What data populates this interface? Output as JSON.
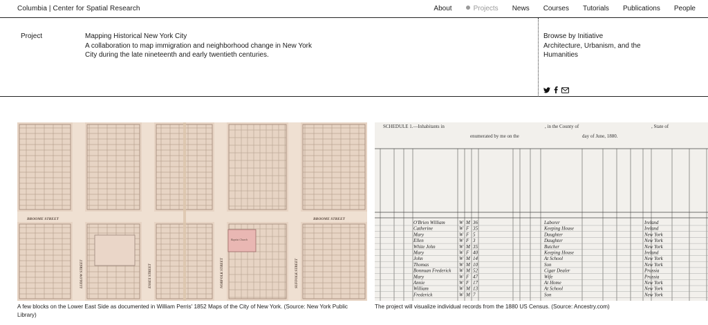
{
  "header": {
    "site_title": "Columbia | Center for Spatial Research",
    "nav": [
      {
        "label": "About",
        "active": false
      },
      {
        "label": "Projects",
        "active": true
      },
      {
        "label": "News",
        "active": false
      },
      {
        "label": "Courses",
        "active": false
      },
      {
        "label": "Tutorials",
        "active": false
      },
      {
        "label": "Publications",
        "active": false
      },
      {
        "label": "People",
        "active": false
      }
    ]
  },
  "project": {
    "label": "Project",
    "title": "Mapping Historical New York City",
    "description": "A collaboration to map immigration and neighborhood change in New York City during the early twentieth centuries.",
    "description_full": "A collaboration to map immigration and neighborhood change in New York City during the late nineteenth and early twentieth centuries."
  },
  "browse": {
    "label": "Browse by Initiative",
    "value": "Architecture, Urbanism, and the Humanities"
  },
  "social": {
    "icons": [
      "twitter-icon",
      "facebook-icon",
      "email-icon"
    ]
  },
  "figures": {
    "map": {
      "street_labels": [
        "BROOME STREET",
        "BROOME STREET",
        "LUDLOW STREET",
        "ESSEX STREET",
        "NORFOLK STREET",
        "SUFFOLK STREET",
        "Baptist Church"
      ],
      "caption": "A few blocks on the Lower East Side as documented in William Perris' 1852 Maps of the City of New York. (Source: New York Public Library)"
    },
    "census": {
      "header_text": "SCHEDULE 1.—Inhabitants in",
      "header_text2": "enumerated by me on the",
      "header_text3": "day of June, 1880.",
      "header_county": ", in the County of",
      "header_state": ", State of",
      "rows": [
        [
          "O'Brien William",
          "W",
          "M",
          "36",
          "Laborer",
          "Ireland"
        ],
        [
          "Catherine",
          "W",
          "F",
          "35",
          "Keeping House",
          "Ireland"
        ],
        [
          "Mary",
          "W",
          "F",
          "5",
          "Daughter",
          "New York"
        ],
        [
          "Ellen",
          "W",
          "F",
          "3",
          "Daughter",
          "New York"
        ],
        [
          "White John",
          "W",
          "M",
          "35",
          "Butcher",
          "New York"
        ],
        [
          "Mary",
          "W",
          "F",
          "40",
          "Keeping House",
          "Ireland"
        ],
        [
          "John",
          "W",
          "M",
          "14",
          "At School",
          "New York"
        ],
        [
          "Thomas",
          "W",
          "M",
          "10",
          "Son",
          "New York"
        ],
        [
          "Bonnuan Frederick",
          "W",
          "M",
          "52",
          "Cigar Dealer",
          "Prussia"
        ],
        [
          "Mary",
          "W",
          "F",
          "47",
          "Wife",
          "Prussia"
        ],
        [
          "Annie",
          "W",
          "F",
          "17",
          "At Home",
          "New York"
        ],
        [
          "William",
          "W",
          "M",
          "13",
          "At School",
          "New York"
        ],
        [
          "Frederick",
          "W",
          "M",
          "7",
          "Son",
          "New York"
        ]
      ],
      "caption": "The project will visualize individual records from the 1880 US Census. (Source: Ancestry.com)"
    }
  }
}
